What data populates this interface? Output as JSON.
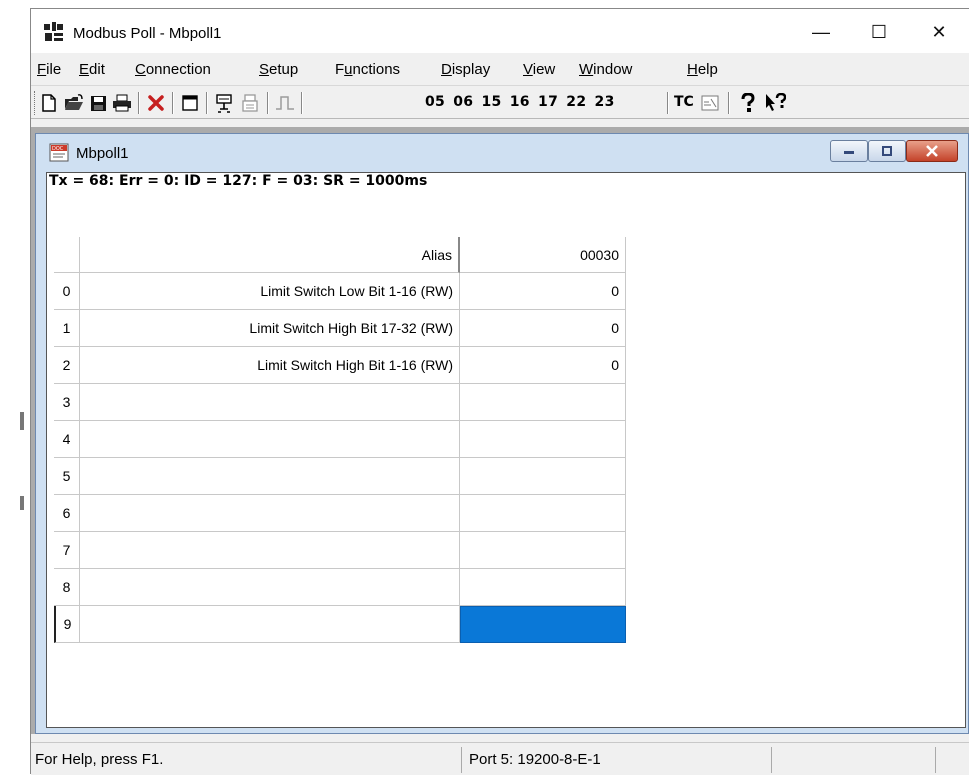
{
  "window": {
    "title": "Modbus Poll - Mbpoll1",
    "minimize": "—",
    "maximize": "☐",
    "close": "✕"
  },
  "menu": [
    "File",
    "Edit",
    "Connection",
    "Setup",
    "Functions",
    "Display",
    "View",
    "Window",
    "Help"
  ],
  "menu_underline": [
    "F",
    "E",
    "C",
    "S",
    "u",
    "D",
    "V",
    "W",
    "H"
  ],
  "toolbar": {
    "function_codes": "05 06 15 16 17 22 23",
    "tc_label": "TC"
  },
  "child": {
    "title": "Mbpoll1",
    "status_line": "Tx = 68: Err = 0: ID = 127: F = 03: SR = 1000ms"
  },
  "grid": {
    "alias_header": "Alias",
    "value_header": "00030",
    "rows": [
      {
        "num": "0",
        "alias": "Limit Switch Low Bit 1-16 (RW)",
        "value": "0"
      },
      {
        "num": "1",
        "alias": "Limit Switch High Bit 17-32 (RW)",
        "value": "0"
      },
      {
        "num": "2",
        "alias": "Limit Switch High Bit 1-16 (RW)",
        "value": "0"
      },
      {
        "num": "3",
        "alias": "",
        "value": ""
      },
      {
        "num": "4",
        "alias": "",
        "value": ""
      },
      {
        "num": "5",
        "alias": "",
        "value": ""
      },
      {
        "num": "6",
        "alias": "",
        "value": ""
      },
      {
        "num": "7",
        "alias": "",
        "value": ""
      },
      {
        "num": "8",
        "alias": "",
        "value": ""
      },
      {
        "num": "9",
        "alias": "",
        "value": ""
      }
    ]
  },
  "statusbar": {
    "help": "For Help, press F1.",
    "port": "Port 5: 19200-8-E-1"
  },
  "colors": {
    "selection": "#0a78d7",
    "child_frame": "#cfe0f2",
    "mdi_background": "#ababab"
  }
}
